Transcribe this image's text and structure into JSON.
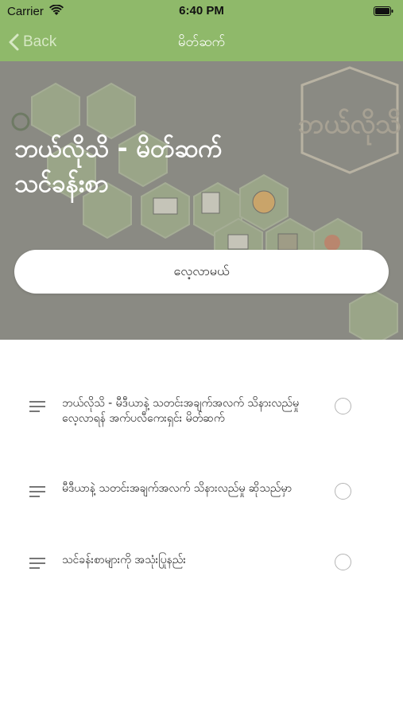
{
  "status_bar": {
    "carrier": "Carrier",
    "time": "6:40 PM"
  },
  "nav": {
    "back_label": "Back",
    "title": "မိတ်ဆက်"
  },
  "hero": {
    "title": "ဘယ်လိုသိ - မိတ်ဆက် သင်ခန်းစာ",
    "button_label": "လေ့လာမယ်"
  },
  "lessons": [
    {
      "label": "ဘယ်လိုသိ - မီဒီယာနဲ့ သတင်းအချက်အလက် သိနားလည်မှု လေ့လာရန် အက်ပလီကေးရှင်း မိတ်ဆက်"
    },
    {
      "label": "မီဒီယာနဲ့ သတင်းအချက်အလက် သိနားလည်မှု ဆိုသည်မှာ"
    },
    {
      "label": "သင်ခန်းစာများကို အသုံးပြုနည်း"
    }
  ],
  "colors": {
    "accent": "#8fb96a",
    "hero_overlay": "#8a8a83"
  }
}
